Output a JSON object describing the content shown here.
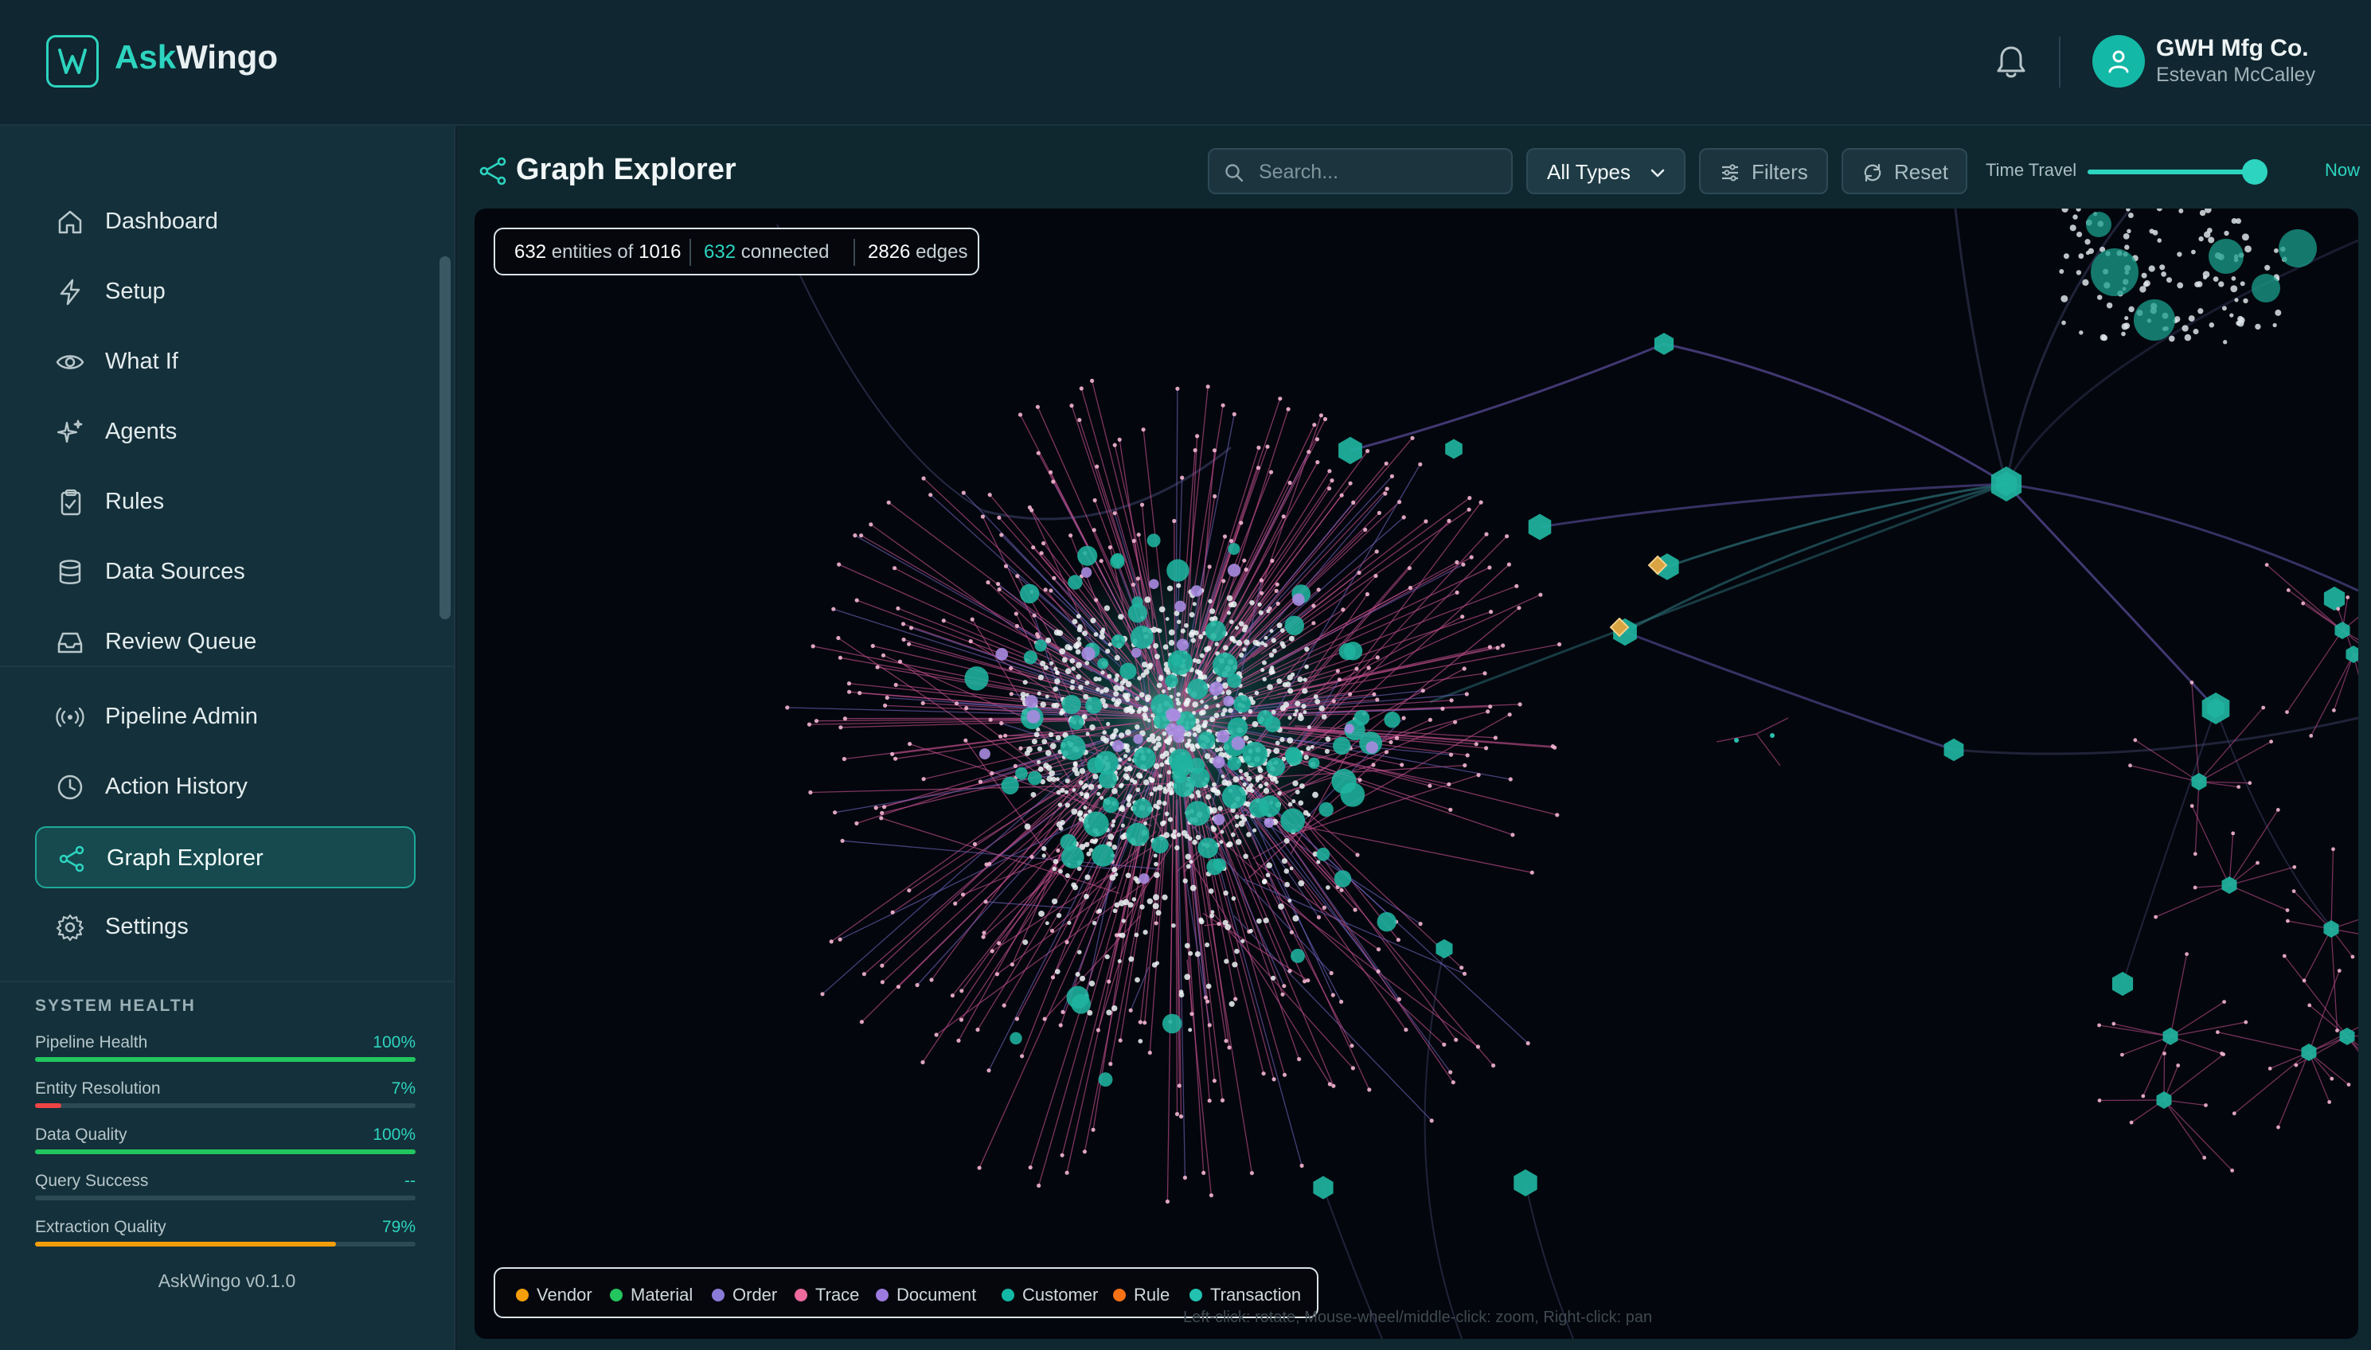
{
  "app": {
    "logo_letter": "W",
    "logo_accent": "Ask",
    "logo_rest": "Wingo",
    "org_name": "GWH Mfg Co.",
    "user_name": "Estevan McCalley",
    "accent_color": "#2dd4bf"
  },
  "sidebar": {
    "items": [
      {
        "label": "Dashboard",
        "icon": "home-icon"
      },
      {
        "label": "Setup",
        "icon": "bolt-icon"
      },
      {
        "label": "What If",
        "icon": "eye-icon"
      },
      {
        "label": "Agents",
        "icon": "sparkles-icon"
      },
      {
        "label": "Rules",
        "icon": "clipboard-check-icon"
      },
      {
        "label": "Data Sources",
        "icon": "database-icon"
      },
      {
        "label": "Review Queue",
        "icon": "inbox-icon"
      },
      {
        "label": "Pipeline Admin",
        "icon": "broadcast-icon"
      },
      {
        "label": "Action History",
        "icon": "clock-icon"
      },
      {
        "label": "Graph Explorer",
        "icon": "share-icon",
        "active": true
      },
      {
        "label": "Settings",
        "icon": "gear-icon"
      }
    ],
    "health": {
      "title": "SYSTEM HEALTH",
      "metrics": [
        {
          "name": "Pipeline Health",
          "value": "100%",
          "fraction": 1.0,
          "color": "#22c55e"
        },
        {
          "name": "Entity Resolution",
          "value": "7%",
          "fraction": 0.07,
          "color": "#ef4444"
        },
        {
          "name": "Data Quality",
          "value": "100%",
          "fraction": 1.0,
          "color": "#22c55e"
        },
        {
          "name": "Query Success",
          "value": "--",
          "fraction": 0.0,
          "color": "#22c55e"
        },
        {
          "name": "Extraction Quality",
          "value": "79%",
          "fraction": 0.79,
          "color": "#f59e0b"
        }
      ]
    },
    "version": "AskWingo v0.1.0"
  },
  "main": {
    "title": "Graph Explorer",
    "search_placeholder": "Search...",
    "type_filter": "All Types",
    "filters_label": "Filters",
    "reset_label": "Reset",
    "time_travel_label": "Time Travel",
    "time_travel_value": "Now",
    "time_travel_fraction": 1.0
  },
  "graph": {
    "stats": {
      "entities": "632",
      "entities_of": "entities of",
      "total": "1016",
      "connected": "632",
      "connected_label": "connected",
      "edges": "2826",
      "edges_label": "edges"
    },
    "legend": [
      {
        "label": "Vendor",
        "color": "#f59e0b"
      },
      {
        "label": "Material",
        "color": "#22c55e"
      },
      {
        "label": "Order",
        "color": "#8b7bd8"
      },
      {
        "label": "Trace",
        "color": "#ec6a9c"
      },
      {
        "label": "Document",
        "color": "#9b7be0"
      },
      {
        "label": "Customer",
        "color": "#14b8a6"
      },
      {
        "label": "Rule",
        "color": "#f97316"
      },
      {
        "label": "Transaction",
        "color": "#22c1b0"
      }
    ],
    "hint": "Left-click: rotate, Mouse-wheel/middle-click: zoom, Right-click: pan"
  }
}
